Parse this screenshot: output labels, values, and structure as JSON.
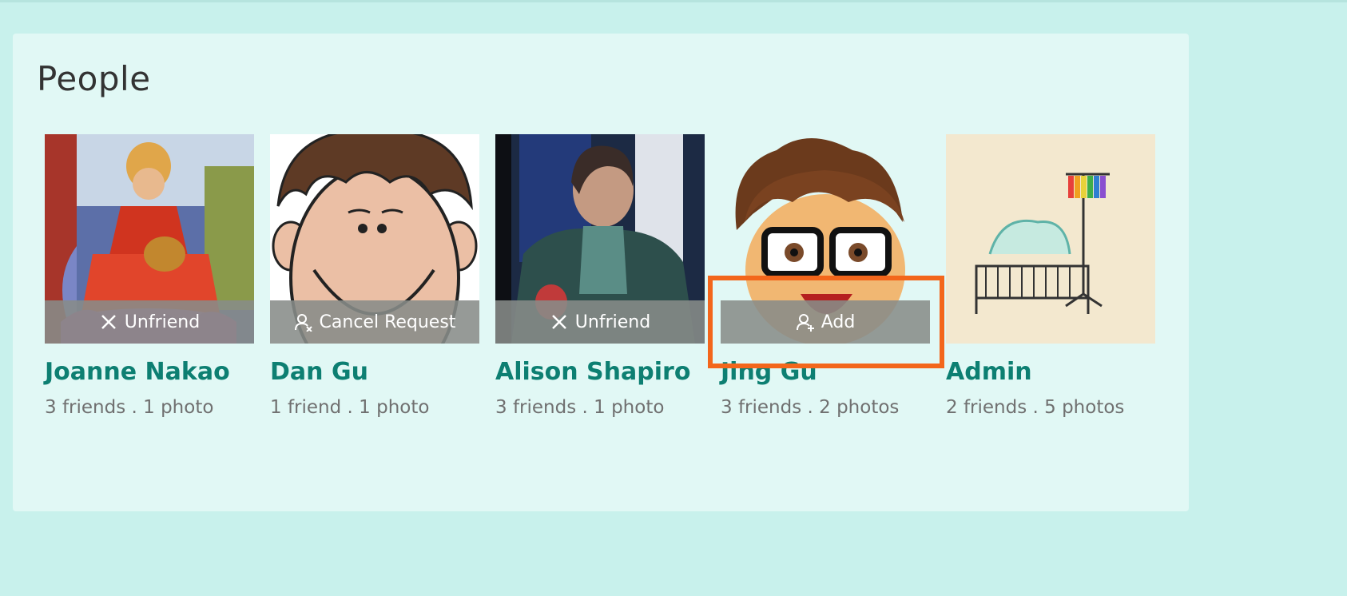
{
  "page": {
    "title": "People"
  },
  "people": [
    {
      "name": "Joanne Nakao",
      "meta": "3 friends . 1 photo",
      "action": "Unfriend",
      "action_icon": "x-icon"
    },
    {
      "name": "Dan Gu",
      "meta": "1 friend . 1 photo",
      "action": "Cancel Request",
      "action_icon": "user-remove-icon"
    },
    {
      "name": "Alison Shapiro",
      "meta": "3 friends . 1 photo",
      "action": "Unfriend",
      "action_icon": "x-icon"
    },
    {
      "name": "Jing Gu",
      "meta": "3 friends . 2 photos",
      "action": "Add",
      "action_icon": "user-add-icon"
    },
    {
      "name": "Admin",
      "meta": "2 friends . 5 photos"
    }
  ],
  "colors": {
    "background": "#c8f1ec",
    "panel": "#e1f8f5",
    "name_link": "#0d7f72",
    "meta_text": "#707070",
    "action_overlay": "#888c89",
    "highlight_box": "#f3661b"
  }
}
